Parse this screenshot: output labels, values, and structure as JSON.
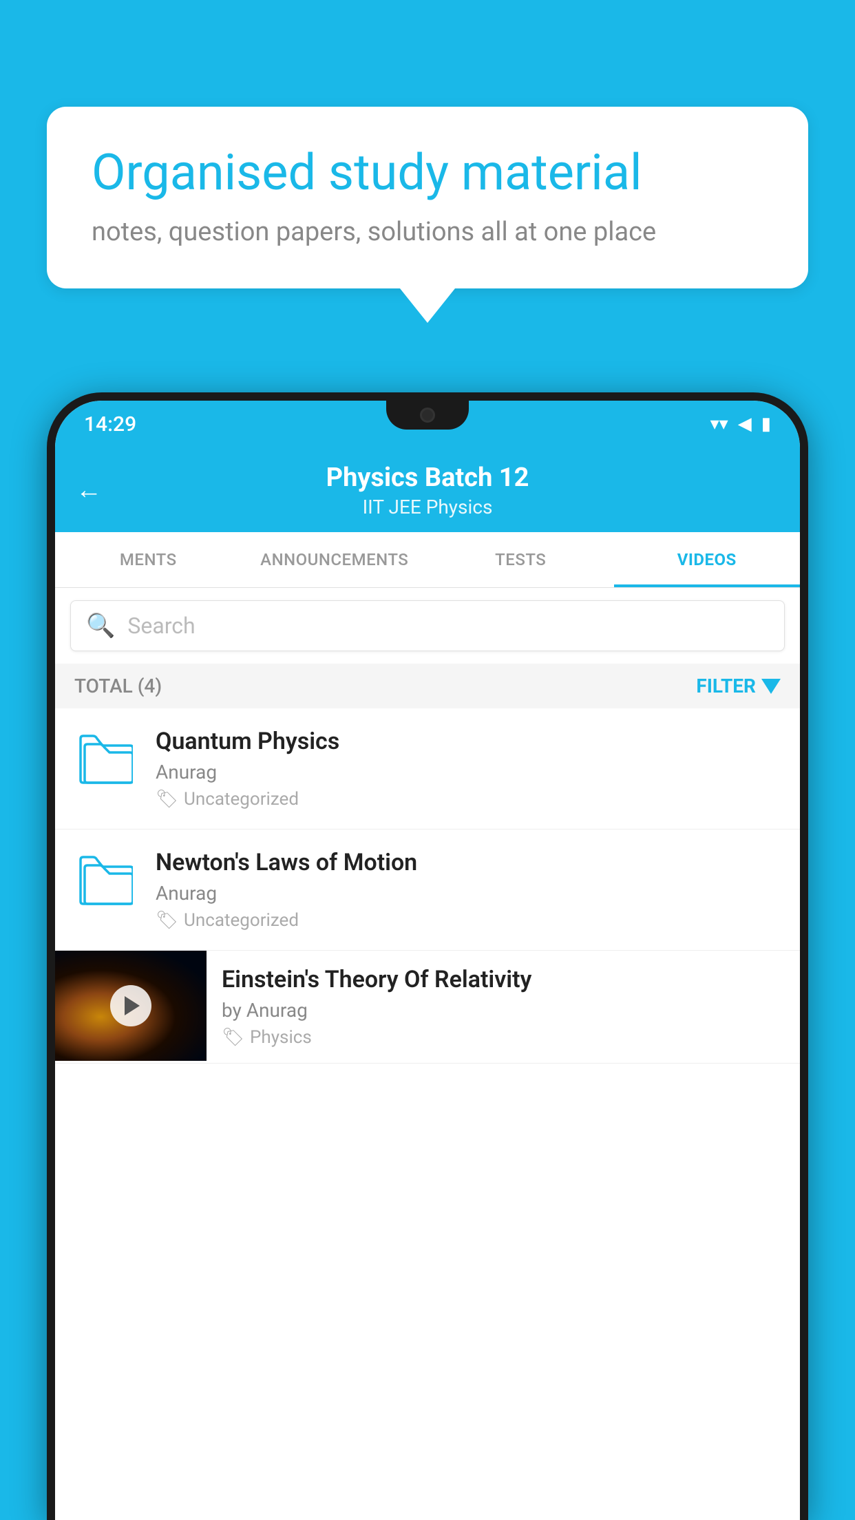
{
  "background": {
    "color": "#1ab8e8"
  },
  "speech_bubble": {
    "title": "Organised study material",
    "subtitle": "notes, question papers, solutions all at one place"
  },
  "phone": {
    "status_bar": {
      "time": "14:29",
      "wifi": "▼",
      "signal": "◀",
      "battery": "▮"
    },
    "header": {
      "back_icon": "←",
      "title": "Physics Batch 12",
      "subtitle": "IIT JEE   Physics"
    },
    "tabs": [
      {
        "label": "MENTS",
        "active": false
      },
      {
        "label": "ANNOUNCEMENTS",
        "active": false
      },
      {
        "label": "TESTS",
        "active": false
      },
      {
        "label": "VIDEOS",
        "active": true
      }
    ],
    "search": {
      "placeholder": "Search"
    },
    "filter_row": {
      "total_label": "TOTAL (4)",
      "filter_label": "FILTER"
    },
    "videos": [
      {
        "type": "folder",
        "title": "Quantum Physics",
        "author": "Anurag",
        "tag": "Uncategorized"
      },
      {
        "type": "folder",
        "title": "Newton's Laws of Motion",
        "author": "Anurag",
        "tag": "Uncategorized"
      },
      {
        "type": "video",
        "title": "Einstein's Theory Of Relativity",
        "author": "by Anurag",
        "tag": "Physics"
      }
    ]
  }
}
